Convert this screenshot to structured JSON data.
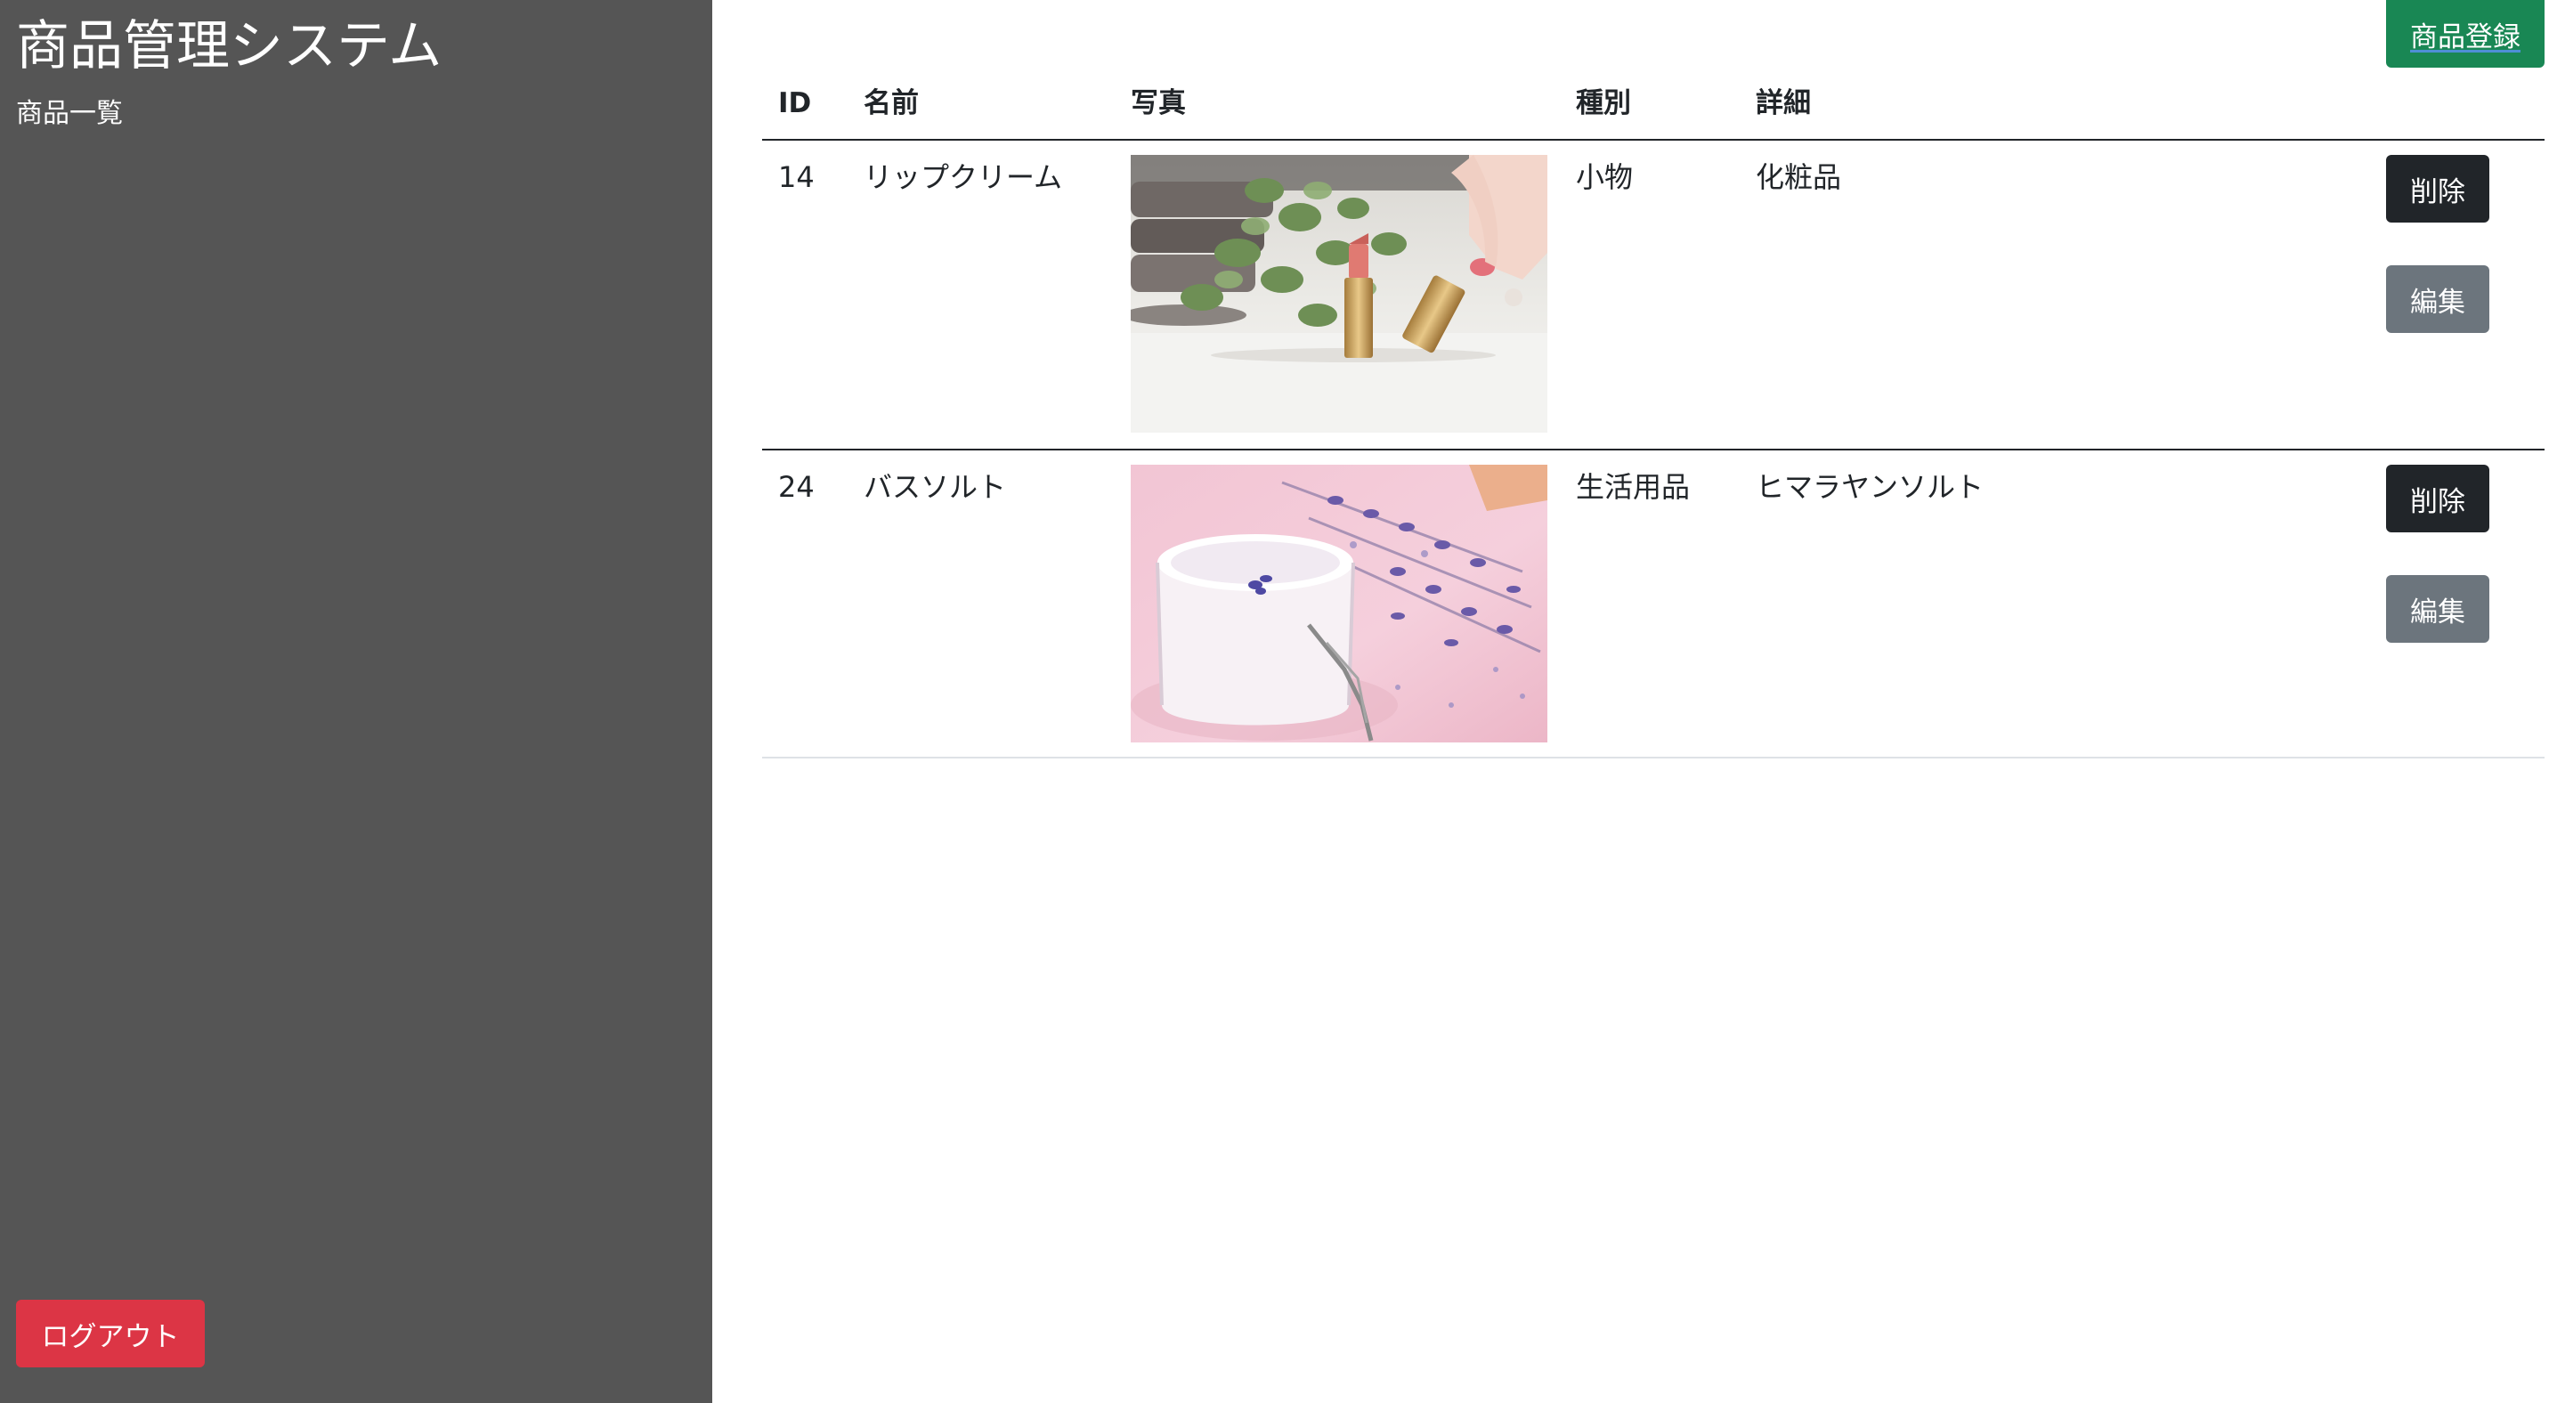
{
  "sidebar": {
    "app_title": "商品管理システム",
    "nav_items": [
      {
        "label": "商品一覧"
      }
    ],
    "logout_label": "ログアウト"
  },
  "toolbar": {
    "register_label": "商品登録"
  },
  "table": {
    "headers": [
      "ID",
      "名前",
      "写真",
      "種別",
      "詳細"
    ],
    "rows": [
      {
        "id": "14",
        "name": "リップクリーム",
        "photo_icon": "lipstick-photo",
        "category": "小物",
        "detail": "化粧品",
        "delete_label": "削除",
        "edit_label": "編集"
      },
      {
        "id": "24",
        "name": "バスソルト",
        "photo_icon": "bath-salt-jar-photo",
        "category": "生活用品",
        "detail": "ヒマラヤンソルト",
        "delete_label": "削除",
        "edit_label": "編集"
      }
    ]
  },
  "colors": {
    "sidebar_bg": "#555555",
    "register": "#198754",
    "logout": "#dc3545",
    "delete": "#212529",
    "edit": "#6c757d"
  }
}
